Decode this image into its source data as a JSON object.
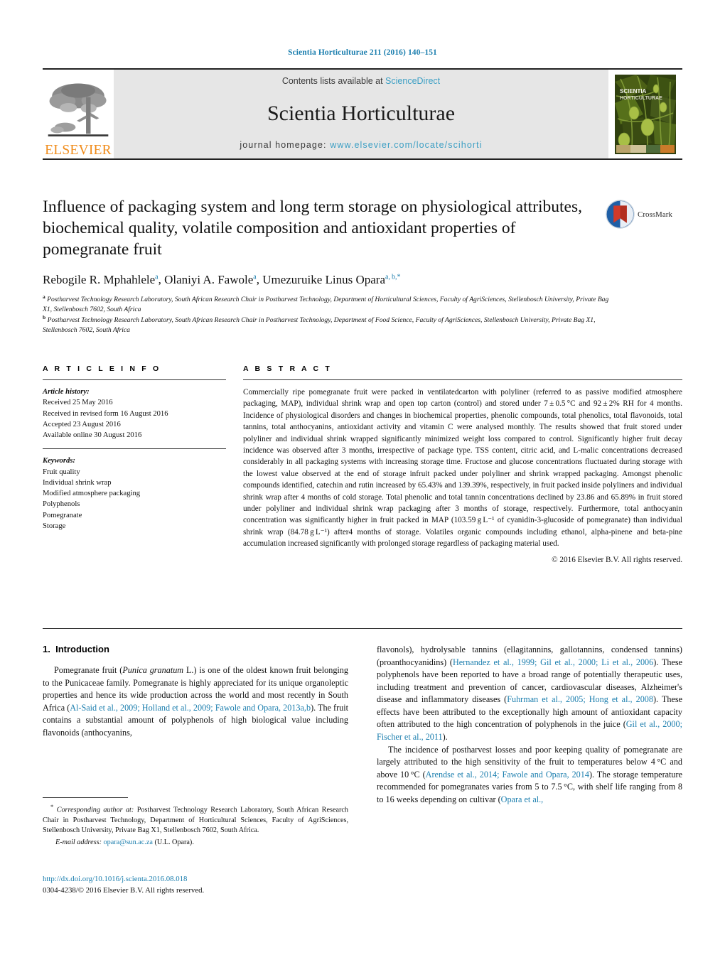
{
  "running_head": "Scientia Horticulturae 211 (2016) 140–151",
  "masthead": {
    "contents_prefix": "Contents lists available at ",
    "contents_link": "ScienceDirect",
    "journal_title": "Scientia Horticulturae",
    "homepage_prefix": "journal homepage: ",
    "homepage_url": "www.elsevier.com/locate/scihorti",
    "publisher_logo_text": "ELSEVIER",
    "cover_caption_line1": "SCIENTIA",
    "cover_caption_line2": "HORTICULTURAE",
    "band_color": "#e6e6e6",
    "link_color": "#3c9fc4"
  },
  "article": {
    "title": "Influence of packaging system and long term storage on physiological attributes, biochemical quality, volatile composition and antioxidant properties of pomegranate fruit",
    "crossmark_label": "CrossMark",
    "authors_html": "Rebogile R. Mphahlele<sup>a</sup>, Olaniyi A. Fawole<sup>a</sup>, Umezuruike Linus Opara<sup>a, b,</sup><sup>*</sup>",
    "affiliation_a": "Postharvest Technology Research Laboratory, South African Research Chair in Postharvest Technology, Department of Horticultural Sciences, Faculty of AgriSciences, Stellenbosch University, Private Bag X1, Stellenbosch 7602, South Africa",
    "affiliation_b": "Postharvest Technology Research Laboratory, South African Research Chair in Postharvest Technology, Department of Food Science, Faculty of AgriSciences, Stellenbosch University, Private Bag X1, Stellenbosch 7602, South Africa",
    "affil_marker_a": "a",
    "affil_marker_b": "b"
  },
  "article_info": {
    "heading": "A R T I C L E   I N F O",
    "history_label": "Article history:",
    "history": [
      "Received 25 May 2016",
      "Received in revised form 16 August 2016",
      "Accepted 23 August 2016",
      "Available online 30 August 2016"
    ],
    "keywords_label": "Keywords:",
    "keywords": [
      "Fruit quality",
      "Individual shrink wrap",
      "Modified atmosphere packaging",
      "Polyphenols",
      "Pomegranate",
      "Storage"
    ]
  },
  "abstract": {
    "heading": "A B S T R A C T",
    "text": "Commercially ripe pomegranate fruit were packed in ventilatedcarton with polyliner (referred to as passive modified atmosphere packaging, MAP), individual shrink wrap and open top carton (control) and stored under 7 ± 0.5 °C and 92 ± 2% RH for 4 months. Incidence of physiological disorders and changes in biochemical properties, phenolic compounds, total phenolics, total flavonoids, total tannins, total anthocyanins, antioxidant activity and vitamin C were analysed monthly. The results showed that fruit stored under polyliner and individual shrink wrapped significantly minimized weight loss compared to control. Significantly higher fruit decay incidence was observed after 3 months, irrespective of package type. TSS content, citric acid, and L-malic concentrations decreased considerably in all packaging systems with increasing storage time. Fructose and glucose concentrations fluctuated during storage with the lowest value observed at the end of storage infruit packed under polyliner and shrink wrapped packaging. Amongst phenolic compounds identified, catechin and rutin increased by 65.43% and 139.39%, respectively, in fruit packed inside polyliners and individual shrink wrap after 4 months of cold storage. Total phenolic and total tannin concentrations declined by 23.86 and 65.89% in fruit stored under polyliner and individual shrink wrap packaging after 3 months of storage, respectively. Furthermore, total anthocyanin concentration was significantly higher in fruit packed in MAP (103.59 g L⁻¹ of cyanidin-3-glucoside of pomegranate) than individual shrink wrap (84.78 g L⁻¹) after4 months of storage. Volatiles organic compounds including ethanol, alpha-pinene and beta-pine accumulation increased significantly with prolonged storage regardless of packaging material used.",
    "copyright": "© 2016 Elsevier B.V. All rights reserved."
  },
  "introduction": {
    "number": "1.",
    "heading": "Introduction",
    "para1_html": "Pomegranate fruit (<i>Punica granatum</i> L.) is one of the oldest known fruit belonging to the Punicaceae family. Pomegranate is highly appreciated for its unique organoleptic properties and hence its wide production across the world and most recently in South Africa (<span class=\"cite\">Al-Said et al., 2009; Holland et al., 2009; Fawole and Opara, 2013a,b</span>). The fruit contains a substantial amount of polyphenols of high biological value including flavonoids (anthocyanins,",
    "para1_cont_html": "flavonols), hydrolysable tannins (ellagitannins, gallotannins, condensed tannins) (proanthocyanidins) (<span class=\"cite\">Hernandez et al., 1999; Gil et al., 2000; Li et al., 2006</span>). These polyphenols have been reported to have a broad range of potentially therapeutic uses, including treatment and prevention of cancer, cardiovascular diseases, Alzheimer's disease and inflammatory diseases (<span class=\"cite\">Fuhrman et al., 2005; Hong et al., 2008</span>). These effects have been attributed to the exceptionally high amount of antioxidant capacity often attributed to the high concentration of polyphenols in the juice (<span class=\"cite\">Gil et al., 2000; Fischer et al., 2011</span>).",
    "para2_html": "The incidence of postharvest losses and poor keeping quality of pomegranate are largely attributed to the high sensitivity of the fruit to temperatures below 4 °C and above 10 °C (<span class=\"cite\">Arendse et al., 2014; Fawole and Opara, 2014</span>). The storage temperature recommended for pomegranates varies from 5 to 7.5 °C, with shelf life ranging from 8 to 16 weeks depending on cultivar (<span class=\"cite\">Opara et al.,</span>"
  },
  "footnote": {
    "marker": "*",
    "text_html": "<span class=\"ital\">Corresponding author at:</span> Postharvest Technology Research Laboratory, South African Research Chair in Postharvest Technology, Department of Horticultural Sciences, Faculty of AgriSciences, Stellenbosch University, Private Bag X1, Stellenbosch 7602, South Africa.",
    "email_label": "E-mail address:",
    "email": "opara@sun.ac.za",
    "email_owner": "(U.L. Opara)."
  },
  "doi_block": {
    "doi_url": "http://dx.doi.org/10.1016/j.scienta.2016.08.018",
    "issn_line": "0304-4238/© 2016 Elsevier B.V. All rights reserved."
  }
}
